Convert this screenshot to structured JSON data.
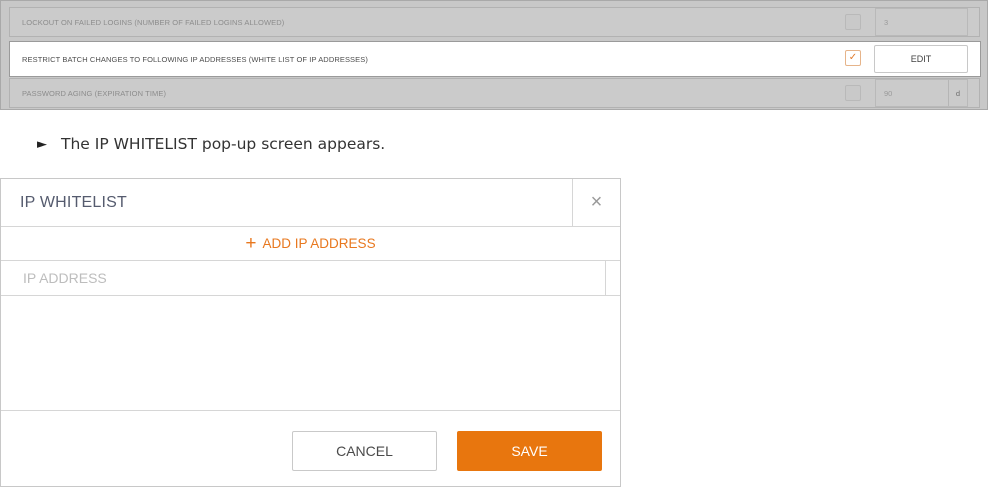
{
  "settings": {
    "rows": [
      {
        "label": "LOCKOUT ON FAILED LOGINS (NUMBER OF FAILED LOGINS ALLOWED)",
        "checked": false,
        "value": "3"
      },
      {
        "label": "RESTRICT BATCH CHANGES TO FOLLOWING IP ADDRESSES (WHITE LIST OF IP ADDRESSES)",
        "checked": true,
        "check_mark": "✓",
        "button_label": "EDIT"
      },
      {
        "label": "PASSWORD AGING (EXPIRATION TIME)",
        "checked": false,
        "value": "90",
        "unit": "d"
      }
    ]
  },
  "instruction": {
    "bullet": "►",
    "text": "The IP WHITELIST pop-up screen appears."
  },
  "dialog": {
    "title": "IP WHITELIST",
    "close_glyph": "×",
    "add_icon": "+",
    "add_label": "ADD IP ADDRESS",
    "column_header": "IP ADDRESS",
    "cancel_label": "CANCEL",
    "save_label": "SAVE"
  },
  "colors": {
    "accent": "#e8760e",
    "panel_bg": "#c8c8c8"
  }
}
